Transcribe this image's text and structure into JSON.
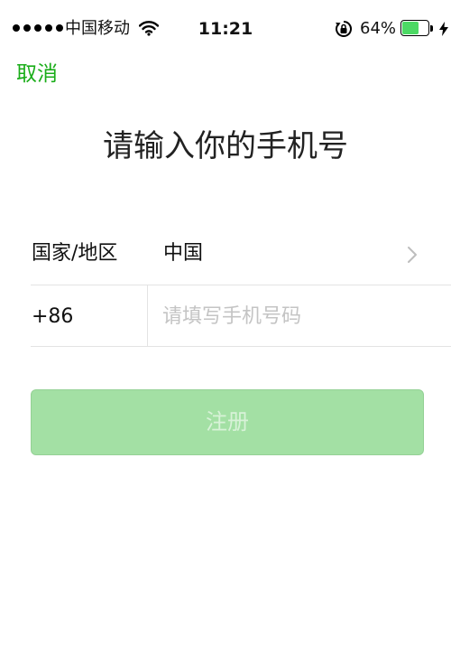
{
  "status_bar": {
    "carrier": "中国移动",
    "time": "11:21",
    "battery_percent": "64%",
    "battery_level": 0.64,
    "icons": [
      "signal-dots",
      "wifi-icon",
      "rotation-lock-icon",
      "battery-icon",
      "charging-icon"
    ]
  },
  "nav": {
    "cancel_label": "取消"
  },
  "title": "请输入你的手机号",
  "form": {
    "country_label": "国家/地区",
    "country_value": "中国",
    "country_code": "+86",
    "phone_placeholder": "请填写手机号码",
    "phone_value": ""
  },
  "register_button_label": "注册",
  "colors": {
    "accent": "#1aad19",
    "button_disabled": "#9fdfa0",
    "divider": "#e3e3e3",
    "placeholder": "#c4c4c4"
  }
}
